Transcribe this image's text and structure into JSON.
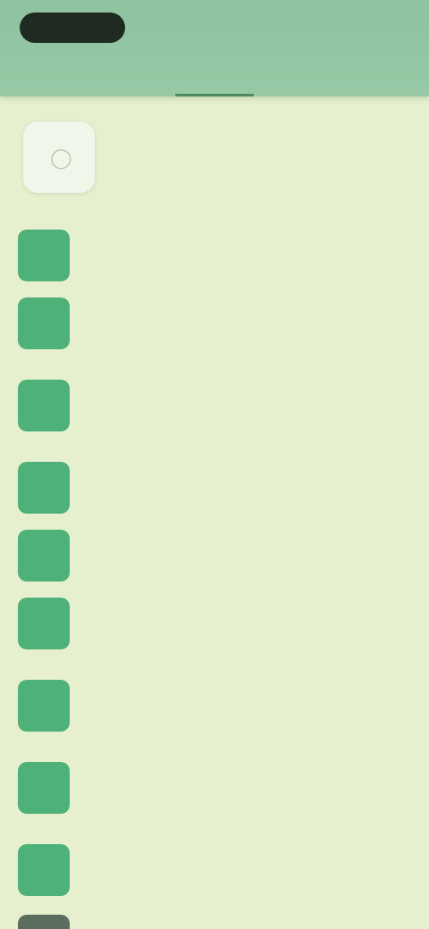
{
  "status_bar": {
    "right_text": ""
  },
  "tabs": {
    "active_label": ""
  },
  "profile": {
    "name": "",
    "avatar_icon": "user-icon"
  },
  "menu": {
    "items": [
      {
        "label": "",
        "icon": "menu-item-icon",
        "height": 76
      },
      {
        "label": "",
        "icon": "menu-item-icon",
        "height": 76
      },
      {
        "label": "",
        "icon": "menu-item-icon",
        "height": 108
      },
      {
        "label": "",
        "icon": "menu-item-icon",
        "height": 76
      },
      {
        "label": "",
        "icon": "menu-item-icon",
        "height": 76
      },
      {
        "label": "",
        "icon": "menu-item-icon",
        "height": 76
      },
      {
        "label": "",
        "icon": "menu-item-icon",
        "height": 108
      },
      {
        "label": "",
        "icon": "menu-item-icon",
        "height": 76
      },
      {
        "label": "",
        "icon": "menu-item-icon",
        "height": 108
      }
    ]
  },
  "colors": {
    "header": "#8ec3a0",
    "background": "#e6f0ce",
    "icon_tile": "#4fb17a",
    "text": "#5e7a62"
  }
}
